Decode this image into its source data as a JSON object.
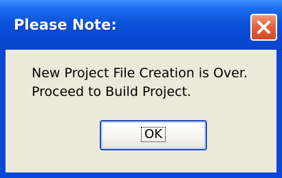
{
  "dialog": {
    "title": "Please Note:",
    "message_line1": "New Project File Creation is Over.",
    "message_line2": "Proceed to Build Project.",
    "ok_label": "OK"
  }
}
